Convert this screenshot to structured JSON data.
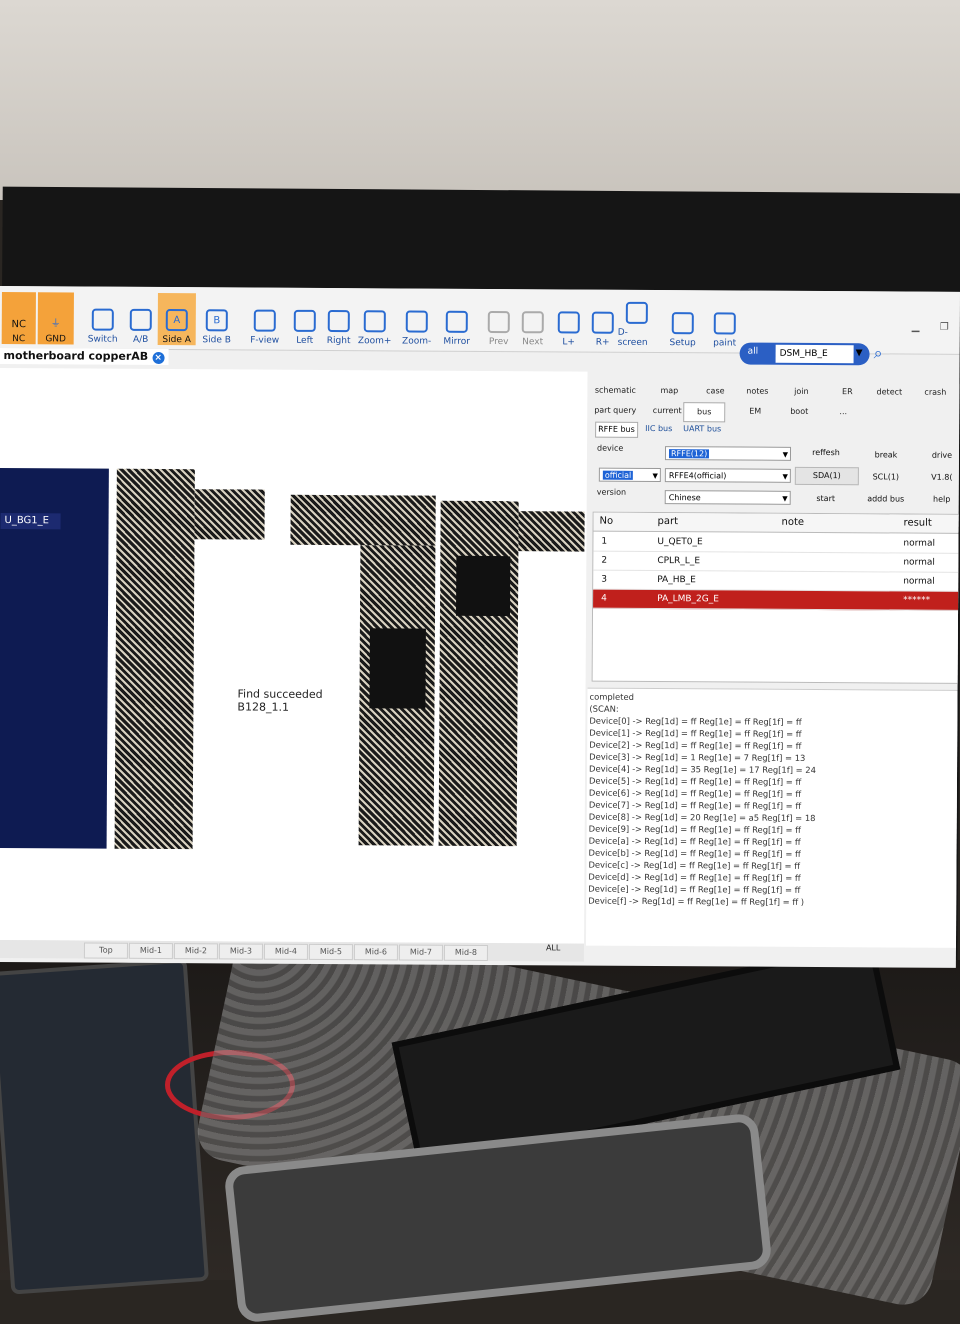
{
  "toolbar": {
    "nc_label": "NC",
    "gnd_label": "GND",
    "nc_top": "NC",
    "items": [
      {
        "label": "Switch",
        "icon": "switch-icon"
      },
      {
        "label": "A/B",
        "icon": "ab-icon"
      },
      {
        "label": "Side A",
        "icon": "side-a-icon",
        "glyph": "A"
      },
      {
        "label": "Side B",
        "icon": "side-b-icon",
        "glyph": "B"
      },
      {
        "label": "F-view",
        "icon": "fullview-icon"
      },
      {
        "label": "Left",
        "icon": "rotate-left-icon"
      },
      {
        "label": "Right",
        "icon": "rotate-right-icon"
      },
      {
        "label": "Zoom+",
        "icon": "zoom-in-icon"
      },
      {
        "label": "Zoom-",
        "icon": "zoom-out-icon"
      },
      {
        "label": "Mirror",
        "icon": "mirror-icon"
      },
      {
        "label": "Prev",
        "icon": "prev-icon"
      },
      {
        "label": "Next",
        "icon": "next-icon"
      },
      {
        "label": "L+",
        "icon": "layer-plus-icon"
      },
      {
        "label": "R+",
        "icon": "r-plus-icon"
      },
      {
        "label": "D-screen",
        "icon": "dual-screen-icon"
      },
      {
        "label": "Setup",
        "icon": "setup-icon"
      },
      {
        "label": "paint",
        "icon": "paint-icon"
      }
    ],
    "search_scope": "all",
    "search_value": "DSM_HB_E"
  },
  "document_tab": "motherboard copperAB",
  "canvas": {
    "chip_label": "U_BG1_E",
    "find_status": "Find succeeded",
    "find_ref": "B128_1.1"
  },
  "layer_tabs": [
    "Top",
    "Mid-1",
    "Mid-2",
    "Mid-3",
    "Mid-4",
    "Mid-5",
    "Mid-6",
    "Mid-7",
    "Mid-8"
  ],
  "layer_all": "ALL",
  "layer_current": "pper",
  "panel": {
    "row1": [
      "schematic",
      "map",
      "case",
      "notes",
      "join",
      "ER",
      "detect",
      "crash"
    ],
    "row2": [
      "part query",
      "current",
      "bus",
      "EM",
      "boot",
      "..."
    ],
    "bus_tabs": [
      "RFFE bus",
      "IIC bus",
      "UART bus"
    ],
    "device_label": "device",
    "device_value": "RFFE(12)",
    "official_value": "official",
    "rffe_value": "RFFE4(official)",
    "version_label": "version",
    "version_value": "Chinese",
    "actions": [
      "reffesh",
      "break",
      "drive",
      "SDA(1)",
      "SCL(1)",
      "V1.8(",
      "start",
      "addd bus",
      "help"
    ]
  },
  "parts_table": {
    "headers": [
      "No",
      "part",
      "note",
      "result"
    ],
    "rows": [
      {
        "no": "1",
        "part": "U_QET0_E",
        "note": "",
        "result": "normal"
      },
      {
        "no": "2",
        "part": "CPLR_L_E",
        "note": "",
        "result": "normal"
      },
      {
        "no": "3",
        "part": "PA_HB_E",
        "note": "",
        "result": "normal"
      },
      {
        "no": "4",
        "part": "PA_LMB_2G_E",
        "note": "",
        "result": "******"
      }
    ]
  },
  "console": [
    "completed",
    "(SCAN:",
    "Device[0] -> Reg[1d] = ff  Reg[1e] = ff  Reg[1f] = ff",
    "Device[1] -> Reg[1d] = ff  Reg[1e] = ff  Reg[1f] = ff",
    "Device[2] -> Reg[1d] = ff  Reg[1e] = ff  Reg[1f] = ff",
    "Device[3] -> Reg[1d] =  1  Reg[1e] =  7  Reg[1f] = 13",
    "Device[4] -> Reg[1d] = 35  Reg[1e] = 17  Reg[1f] = 24",
    "Device[5] -> Reg[1d] = ff  Reg[1e] = ff  Reg[1f] = ff",
    "Device[6] -> Reg[1d] = ff  Reg[1e] = ff  Reg[1f] = ff",
    "Device[7] -> Reg[1d] = ff  Reg[1e] = ff  Reg[1f] = ff",
    "Device[8] -> Reg[1d] = 20  Reg[1e] = a5  Reg[1f] = 18",
    "Device[9] -> Reg[1d] = ff  Reg[1e] = ff  Reg[1f] = ff",
    "Device[a] -> Reg[1d] = ff  Reg[1e] = ff  Reg[1f] = ff",
    "Device[b] -> Reg[1d] = ff  Reg[1e] = ff  Reg[1f] = ff",
    "Device[c] -> Reg[1d] = ff  Reg[1e] = ff  Reg[1f] = ff",
    "Device[d] -> Reg[1d] = ff  Reg[1e] = ff  Reg[1f] = ff",
    "Device[e] -> Reg[1d] = ff  Reg[1e] = ff  Reg[1f] = ff",
    "Device[f] -> Reg[1d] = ff  Reg[1e] = ff  Reg[1f] = ff )"
  ],
  "colors": {
    "accent": "#2a6bd1",
    "active_tab": "#f6b65c",
    "error_row": "#c0201c",
    "board": "#0e1b52"
  }
}
